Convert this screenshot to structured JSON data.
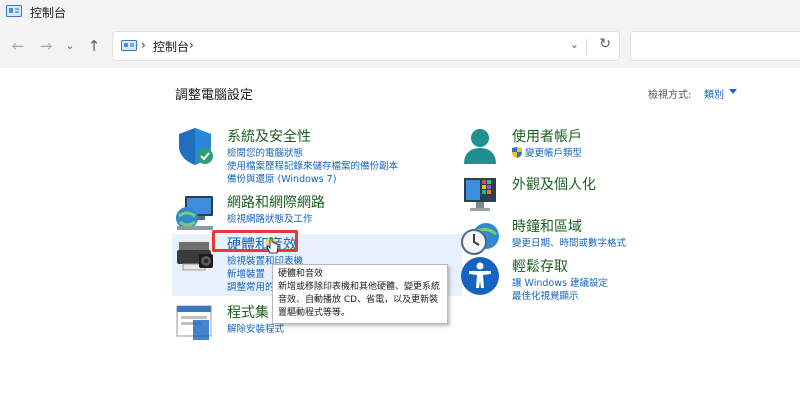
{
  "window": {
    "title": "控制台"
  },
  "address_bar": {
    "breadcrumb": "控制台",
    "separator": "›"
  },
  "nav": {
    "back": "←",
    "forward": "→",
    "recent": "⌄",
    "up": "↑",
    "dropdown": "⌄",
    "refresh": "↻"
  },
  "page": {
    "title": "調整電腦設定",
    "view_by_label": "檢視方式:",
    "view_by_value": "類別"
  },
  "left_categories": [
    {
      "name": "系統及安全性",
      "icon": "shield-icon",
      "links": [
        "檢閱您的電腦狀態",
        "使用檔案歷程記錄來儲存檔案的備份副本",
        "備份與還原 (Windows 7)"
      ]
    },
    {
      "name": "網路和網際網路",
      "icon": "network-globe-icon",
      "links": [
        "檢視網路狀態及工作"
      ]
    },
    {
      "name": "硬體和音效",
      "icon": "printer-icon",
      "links": [
        "檢視裝置和印表機",
        "新增裝置",
        "調整常用的"
      ]
    },
    {
      "name": "程式集",
      "icon": "programs-icon",
      "links": [
        "解除安裝程式"
      ]
    }
  ],
  "right_categories": [
    {
      "name": "使用者帳戶",
      "icon": "user-accounts-icon",
      "links": [
        "變更帳戶類型"
      ]
    },
    {
      "name": "外觀及個人化",
      "icon": "appearance-icon",
      "links": []
    },
    {
      "name": "時鐘和區域",
      "icon": "clock-globe-icon",
      "links": [
        "變更日期、時間或數字格式"
      ]
    },
    {
      "name": "輕鬆存取",
      "icon": "accessibility-icon",
      "links": [
        "讓 Windows 建議設定",
        "最佳化視覺顯示"
      ]
    }
  ],
  "tooltip": {
    "title": "硬體和音效",
    "body": "新增或移除印表機和其他硬體、變更系統音效、自動播放 CD、省電，以及更新裝置驅動程式等等。"
  },
  "colors": {
    "accent": "#1565c0",
    "heading": "#1b5e20",
    "highlight_border": "#e53935",
    "hover": "#e8f1fb"
  }
}
